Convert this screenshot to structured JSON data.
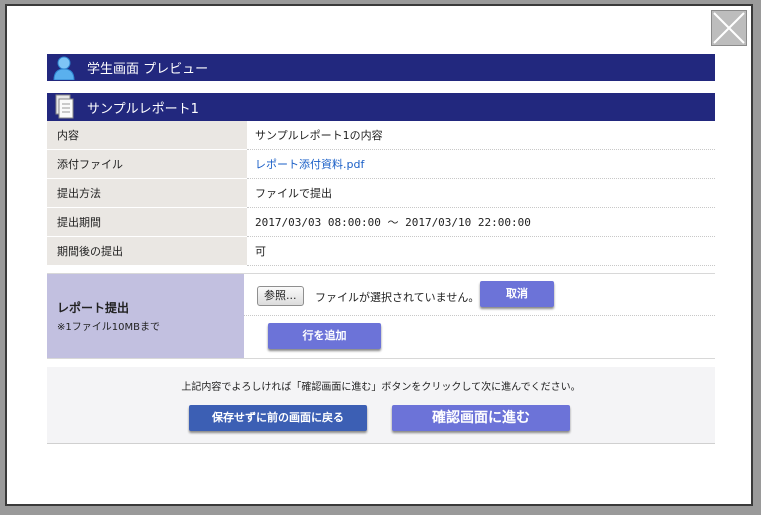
{
  "header": {
    "title": "学生画面 プレビュー"
  },
  "report": {
    "title": "サンプルレポート1"
  },
  "info_rows": [
    {
      "label": "内容",
      "value": "サンプルレポート1の内容"
    },
    {
      "label": "添付ファイル",
      "value": "レポート添付資料.pdf"
    },
    {
      "label": "提出方法",
      "value": "ファイルで提出"
    },
    {
      "label": "提出期間",
      "value": "2017/03/03 08:00:00 〜 2017/03/10 22:00:00"
    },
    {
      "label": "期間後の提出",
      "value": "可"
    }
  ],
  "submit": {
    "label": "レポート提出",
    "note": "※1ファイル10MBまで",
    "browse_label": "参照...",
    "file_status": "ファイルが選択されていません。",
    "cancel_label": "取消",
    "add_row_label": "行を追加"
  },
  "footer": {
    "message": "上記内容でよろしければ「確認画面に進む」ボタンをクリックして次に進んでください。",
    "back_label": "保存せずに前の画面に戻る",
    "confirm_label": "確認画面に進む"
  },
  "colors": {
    "header_bar": "#22287e",
    "button": "#6c73d8",
    "back_button": "#3c5fb4",
    "submit_label_bg": "#c2c0e0"
  }
}
